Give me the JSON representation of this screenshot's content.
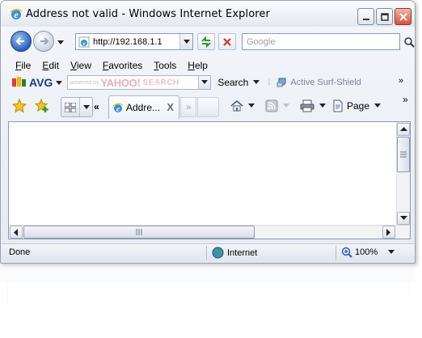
{
  "window": {
    "title": "Address not valid - Windows Internet Explorer"
  },
  "address_bar": {
    "url": "http://192.168.1.1",
    "search_placeholder": "Google"
  },
  "menu": {
    "items": [
      {
        "label_ul": "F",
        "label_rest": "ile"
      },
      {
        "label_ul": "E",
        "label_rest": "dit"
      },
      {
        "label_ul": "V",
        "label_rest": "iew"
      },
      {
        "label_ul": "F",
        "label_rest": "avorites"
      },
      {
        "label_ul": "T",
        "label_rest": "ools"
      },
      {
        "label_ul": "H",
        "label_rest": "elp"
      }
    ]
  },
  "avg_toolbar": {
    "logo_text": "AVG",
    "yahoo_powered": "powered by",
    "yahoo_brand": "YAHOO!",
    "yahoo_search": "SEARCH",
    "search_label": "Search",
    "active_label": "Active",
    "surf_shield_label": "Surf-Shield",
    "more": "»"
  },
  "tabs": {
    "scroll_left": "«",
    "scroll_right": "»",
    "active_tab_title": "Addre...",
    "close_glyph": "X"
  },
  "command_bar": {
    "page_label": "Page",
    "chevron": "»"
  },
  "content": {
    "clipped_text": "... . . . . . . . . ."
  },
  "status_bar": {
    "status_text": "Done",
    "zone": "Internet",
    "zoom": "100%"
  },
  "colors": {
    "accent_blue": "#2a62c4",
    "window_bg": "#e6eaf1",
    "yahoo_faded": "#e8b0b7"
  },
  "icons": {
    "back": "back-arrow-icon",
    "forward": "forward-arrow-icon",
    "refresh": "refresh-icon",
    "stop": "stop-icon",
    "favorites": "favorites-star-icon",
    "add_favorites": "add-favorites-icon",
    "home": "home-icon",
    "feeds": "rss-feed-icon",
    "print": "printer-icon",
    "globe": "internet-globe-icon",
    "zoom": "zoom-icon"
  }
}
